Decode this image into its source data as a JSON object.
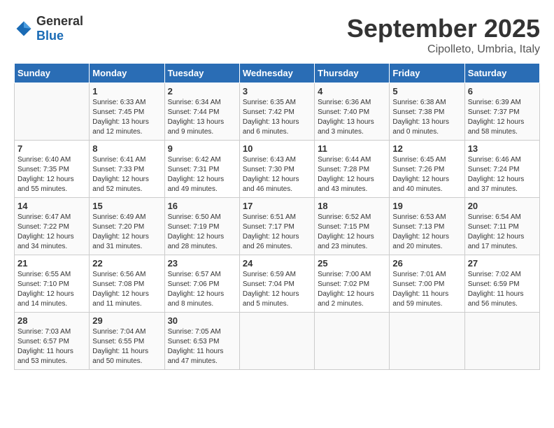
{
  "header": {
    "logo_general": "General",
    "logo_blue": "Blue",
    "month_title": "September 2025",
    "location": "Cipolleto, Umbria, Italy"
  },
  "days_of_week": [
    "Sunday",
    "Monday",
    "Tuesday",
    "Wednesday",
    "Thursday",
    "Friday",
    "Saturday"
  ],
  "weeks": [
    [
      {
        "day": "",
        "sunrise": "",
        "sunset": "",
        "daylight": ""
      },
      {
        "day": "1",
        "sunrise": "Sunrise: 6:33 AM",
        "sunset": "Sunset: 7:45 PM",
        "daylight": "Daylight: 13 hours and 12 minutes."
      },
      {
        "day": "2",
        "sunrise": "Sunrise: 6:34 AM",
        "sunset": "Sunset: 7:44 PM",
        "daylight": "Daylight: 13 hours and 9 minutes."
      },
      {
        "day": "3",
        "sunrise": "Sunrise: 6:35 AM",
        "sunset": "Sunset: 7:42 PM",
        "daylight": "Daylight: 13 hours and 6 minutes."
      },
      {
        "day": "4",
        "sunrise": "Sunrise: 6:36 AM",
        "sunset": "Sunset: 7:40 PM",
        "daylight": "Daylight: 13 hours and 3 minutes."
      },
      {
        "day": "5",
        "sunrise": "Sunrise: 6:38 AM",
        "sunset": "Sunset: 7:38 PM",
        "daylight": "Daylight: 13 hours and 0 minutes."
      },
      {
        "day": "6",
        "sunrise": "Sunrise: 6:39 AM",
        "sunset": "Sunset: 7:37 PM",
        "daylight": "Daylight: 12 hours and 58 minutes."
      }
    ],
    [
      {
        "day": "7",
        "sunrise": "Sunrise: 6:40 AM",
        "sunset": "Sunset: 7:35 PM",
        "daylight": "Daylight: 12 hours and 55 minutes."
      },
      {
        "day": "8",
        "sunrise": "Sunrise: 6:41 AM",
        "sunset": "Sunset: 7:33 PM",
        "daylight": "Daylight: 12 hours and 52 minutes."
      },
      {
        "day": "9",
        "sunrise": "Sunrise: 6:42 AM",
        "sunset": "Sunset: 7:31 PM",
        "daylight": "Daylight: 12 hours and 49 minutes."
      },
      {
        "day": "10",
        "sunrise": "Sunrise: 6:43 AM",
        "sunset": "Sunset: 7:30 PM",
        "daylight": "Daylight: 12 hours and 46 minutes."
      },
      {
        "day": "11",
        "sunrise": "Sunrise: 6:44 AM",
        "sunset": "Sunset: 7:28 PM",
        "daylight": "Daylight: 12 hours and 43 minutes."
      },
      {
        "day": "12",
        "sunrise": "Sunrise: 6:45 AM",
        "sunset": "Sunset: 7:26 PM",
        "daylight": "Daylight: 12 hours and 40 minutes."
      },
      {
        "day": "13",
        "sunrise": "Sunrise: 6:46 AM",
        "sunset": "Sunset: 7:24 PM",
        "daylight": "Daylight: 12 hours and 37 minutes."
      }
    ],
    [
      {
        "day": "14",
        "sunrise": "Sunrise: 6:47 AM",
        "sunset": "Sunset: 7:22 PM",
        "daylight": "Daylight: 12 hours and 34 minutes."
      },
      {
        "day": "15",
        "sunrise": "Sunrise: 6:49 AM",
        "sunset": "Sunset: 7:20 PM",
        "daylight": "Daylight: 12 hours and 31 minutes."
      },
      {
        "day": "16",
        "sunrise": "Sunrise: 6:50 AM",
        "sunset": "Sunset: 7:19 PM",
        "daylight": "Daylight: 12 hours and 28 minutes."
      },
      {
        "day": "17",
        "sunrise": "Sunrise: 6:51 AM",
        "sunset": "Sunset: 7:17 PM",
        "daylight": "Daylight: 12 hours and 26 minutes."
      },
      {
        "day": "18",
        "sunrise": "Sunrise: 6:52 AM",
        "sunset": "Sunset: 7:15 PM",
        "daylight": "Daylight: 12 hours and 23 minutes."
      },
      {
        "day": "19",
        "sunrise": "Sunrise: 6:53 AM",
        "sunset": "Sunset: 7:13 PM",
        "daylight": "Daylight: 12 hours and 20 minutes."
      },
      {
        "day": "20",
        "sunrise": "Sunrise: 6:54 AM",
        "sunset": "Sunset: 7:11 PM",
        "daylight": "Daylight: 12 hours and 17 minutes."
      }
    ],
    [
      {
        "day": "21",
        "sunrise": "Sunrise: 6:55 AM",
        "sunset": "Sunset: 7:10 PM",
        "daylight": "Daylight: 12 hours and 14 minutes."
      },
      {
        "day": "22",
        "sunrise": "Sunrise: 6:56 AM",
        "sunset": "Sunset: 7:08 PM",
        "daylight": "Daylight: 12 hours and 11 minutes."
      },
      {
        "day": "23",
        "sunrise": "Sunrise: 6:57 AM",
        "sunset": "Sunset: 7:06 PM",
        "daylight": "Daylight: 12 hours and 8 minutes."
      },
      {
        "day": "24",
        "sunrise": "Sunrise: 6:59 AM",
        "sunset": "Sunset: 7:04 PM",
        "daylight": "Daylight: 12 hours and 5 minutes."
      },
      {
        "day": "25",
        "sunrise": "Sunrise: 7:00 AM",
        "sunset": "Sunset: 7:02 PM",
        "daylight": "Daylight: 12 hours and 2 minutes."
      },
      {
        "day": "26",
        "sunrise": "Sunrise: 7:01 AM",
        "sunset": "Sunset: 7:00 PM",
        "daylight": "Daylight: 11 hours and 59 minutes."
      },
      {
        "day": "27",
        "sunrise": "Sunrise: 7:02 AM",
        "sunset": "Sunset: 6:59 PM",
        "daylight": "Daylight: 11 hours and 56 minutes."
      }
    ],
    [
      {
        "day": "28",
        "sunrise": "Sunrise: 7:03 AM",
        "sunset": "Sunset: 6:57 PM",
        "daylight": "Daylight: 11 hours and 53 minutes."
      },
      {
        "day": "29",
        "sunrise": "Sunrise: 7:04 AM",
        "sunset": "Sunset: 6:55 PM",
        "daylight": "Daylight: 11 hours and 50 minutes."
      },
      {
        "day": "30",
        "sunrise": "Sunrise: 7:05 AM",
        "sunset": "Sunset: 6:53 PM",
        "daylight": "Daylight: 11 hours and 47 minutes."
      },
      {
        "day": "",
        "sunrise": "",
        "sunset": "",
        "daylight": ""
      },
      {
        "day": "",
        "sunrise": "",
        "sunset": "",
        "daylight": ""
      },
      {
        "day": "",
        "sunrise": "",
        "sunset": "",
        "daylight": ""
      },
      {
        "day": "",
        "sunrise": "",
        "sunset": "",
        "daylight": ""
      }
    ]
  ]
}
